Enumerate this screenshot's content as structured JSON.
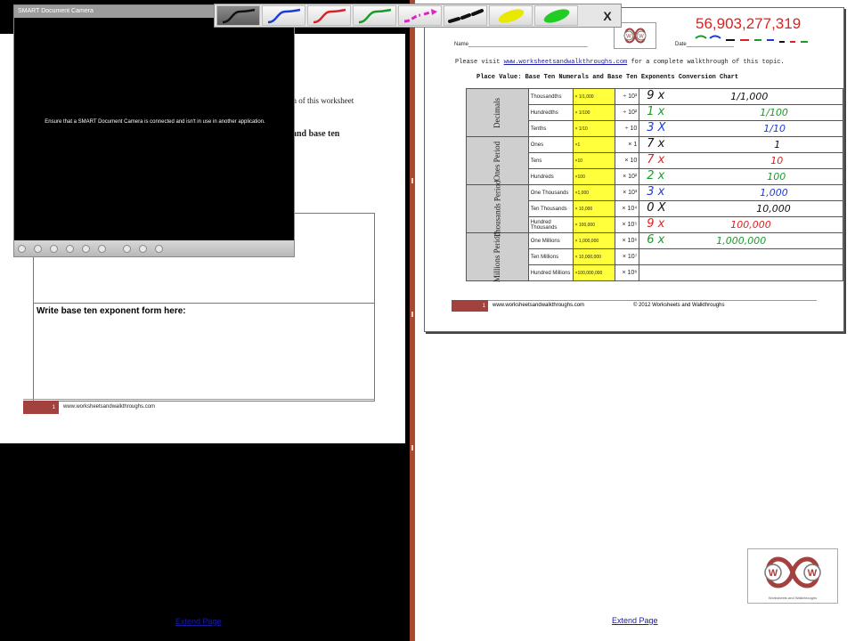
{
  "toolbar": {
    "pens": [
      {
        "name": "black-pen-icon",
        "color": "#1a1a1a",
        "selected": true
      },
      {
        "name": "blue-pen-icon",
        "color": "#1f3bd6"
      },
      {
        "name": "red-pen-icon",
        "color": "#e02020"
      },
      {
        "name": "green-pen-icon",
        "color": "#1a9a2a"
      },
      {
        "name": "magenta-pen-icon",
        "color": "#e020c8"
      },
      {
        "name": "black-dashed-pen-icon",
        "color": "#111111"
      },
      {
        "name": "yellow-highlighter-icon",
        "color": "#e8e800"
      },
      {
        "name": "green-highlighter-icon",
        "color": "#22cc22"
      }
    ],
    "close_label": "X"
  },
  "camera": {
    "title": "SMART Document Camera",
    "message": "Ensure that a SMART Document Camera is connected and isn't in use in another application."
  },
  "left_page": {
    "frag_line1": "gh of this worksheet",
    "frag_line2": "and base ten",
    "answer_label": "Write base ten exponent form here:",
    "page_number": "1",
    "footer_url": "www.worksheetsandwalkthroughs.com",
    "extend_label": "Extend Page"
  },
  "right_page": {
    "big_number": "56,903,277,319",
    "name_label": "Name",
    "date_label": "Date",
    "visit_prefix": "Please visit",
    "visit_link": "www.worksheetsandwalkthroughs.com",
    "visit_suffix": "for a complete walkthrough of this topic.",
    "title": "Place Value: Base Ten Numerals and Base Ten Exponents Conversion Chart",
    "periods": [
      {
        "label": "Decimals",
        "rows": 3
      },
      {
        "label": "Ones Period",
        "rows": 3
      },
      {
        "label": "Thousands Period",
        "rows": 3
      },
      {
        "label": "Millions Period",
        "rows": 3
      }
    ],
    "rows": [
      {
        "place": "Thousandths",
        "mult": "× 1/1,000",
        "op": "÷ 10³"
      },
      {
        "place": "Hundredths",
        "mult": "× 1/100",
        "op": "÷ 10²"
      },
      {
        "place": "Tenths",
        "mult": "× 1/10",
        "op": "÷ 10"
      },
      {
        "place": "Ones",
        "mult": "×1",
        "op": "× 1"
      },
      {
        "place": "Tens",
        "mult": "×10",
        "op": "× 10"
      },
      {
        "place": "Hundreds",
        "mult": "×100",
        "op": "× 10²"
      },
      {
        "place": "One Thousands",
        "mult": "×1,000",
        "op": "× 10³"
      },
      {
        "place": "Ten Thousands",
        "mult": "× 10,000",
        "op": "× 10⁴"
      },
      {
        "place": "Hundred Thousands",
        "mult": "× 100,000",
        "op": "× 10⁵"
      },
      {
        "place": "One Millions",
        "mult": "× 1,000,000",
        "op": "× 10⁶"
      },
      {
        "place": "Ten Millions",
        "mult": "× 10,000,000",
        "op": "× 10⁷"
      },
      {
        "place": "Hundred Millions",
        "mult": "×100,000,000",
        "op": "× 10⁸"
      }
    ],
    "handwriting": [
      {
        "digit": "9 x",
        "value": "1/1,000",
        "color": "#111111"
      },
      {
        "digit": "1 x",
        "value": "1/100",
        "color": "#1a9a2a"
      },
      {
        "digit": "3 X",
        "value": "1/10",
        "color": "#1f3bd6"
      },
      {
        "digit": "7 x",
        "value": "1",
        "color": "#111111"
      },
      {
        "digit": "7 x",
        "value": "10",
        "color": "#e02020"
      },
      {
        "digit": "2 x",
        "value": "100",
        "color": "#1a9a2a"
      },
      {
        "digit": "3 x",
        "value": "1,000",
        "color": "#1f3bd6"
      },
      {
        "digit": "0 X",
        "value": "10,000",
        "color": "#111111"
      },
      {
        "digit": "9 x",
        "value": "100,000",
        "color": "#e02020"
      },
      {
        "digit": "6 x",
        "value": "1,000,000",
        "color": "#1a9a2a"
      }
    ],
    "page_number": "1",
    "footer_url": "www.worksheetsandwalkthroughs.com",
    "copyright": "© 2012 Worksheets and Walkthroughs",
    "extend_label": "Extend Page",
    "logo_caption": "Worksheets and Walkthroughs"
  }
}
